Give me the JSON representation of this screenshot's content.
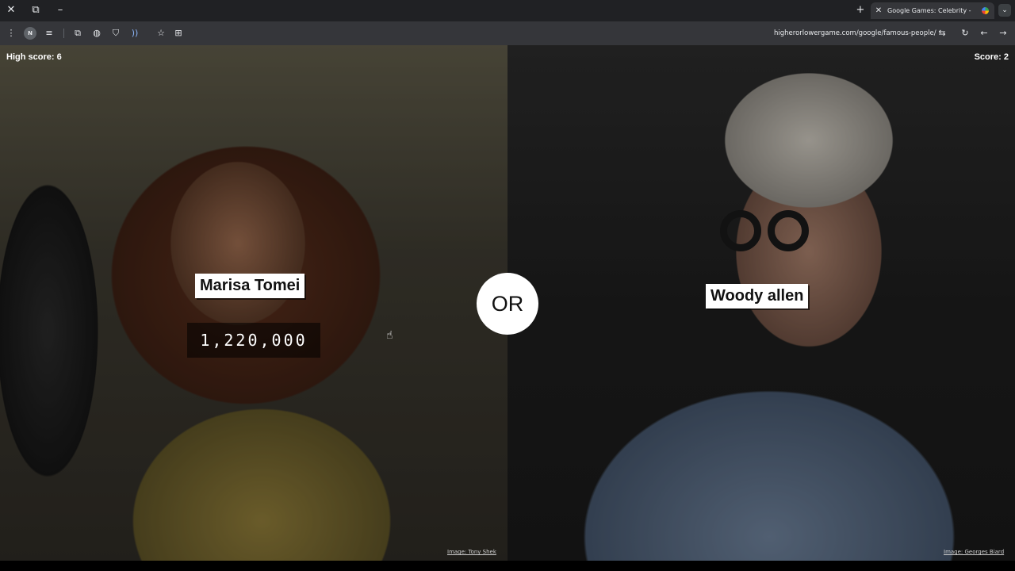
{
  "browser": {
    "window_controls": {
      "close": "✕",
      "restore": "⧉",
      "minimize": "–"
    },
    "new_tab": "+",
    "tab": {
      "title": "Google Games: Celebrity - Who",
      "close": "✕"
    },
    "tab_menu": "⌄",
    "extensions": {
      "n_badge": "N"
    },
    "url": "higherorlowergame.com/google/famous-people/",
    "icons": {
      "menu": "⋮",
      "reading": "≡",
      "extension": "⧉",
      "globe": "◍",
      "shield": "⛉",
      "wave": "))",
      "star": "☆",
      "translate": "⊞",
      "tune": "⇆",
      "reload": "↻",
      "back": "←",
      "forward": "→"
    }
  },
  "game": {
    "high_score": "High score: 6",
    "score": "Score: 2",
    "or_label": "OR",
    "left": {
      "name": "Marisa Tomei",
      "searches": "1,220,000",
      "credit": "Image: Tony Shek"
    },
    "right": {
      "name": "Woody allen",
      "credit": "Image: Georges Biard"
    }
  },
  "colors": {
    "chrome_dark": "#202124",
    "chrome_toolbar": "#35363a",
    "tag_bg": "#ffffff",
    "accent_blue": "#8ab4f8"
  }
}
